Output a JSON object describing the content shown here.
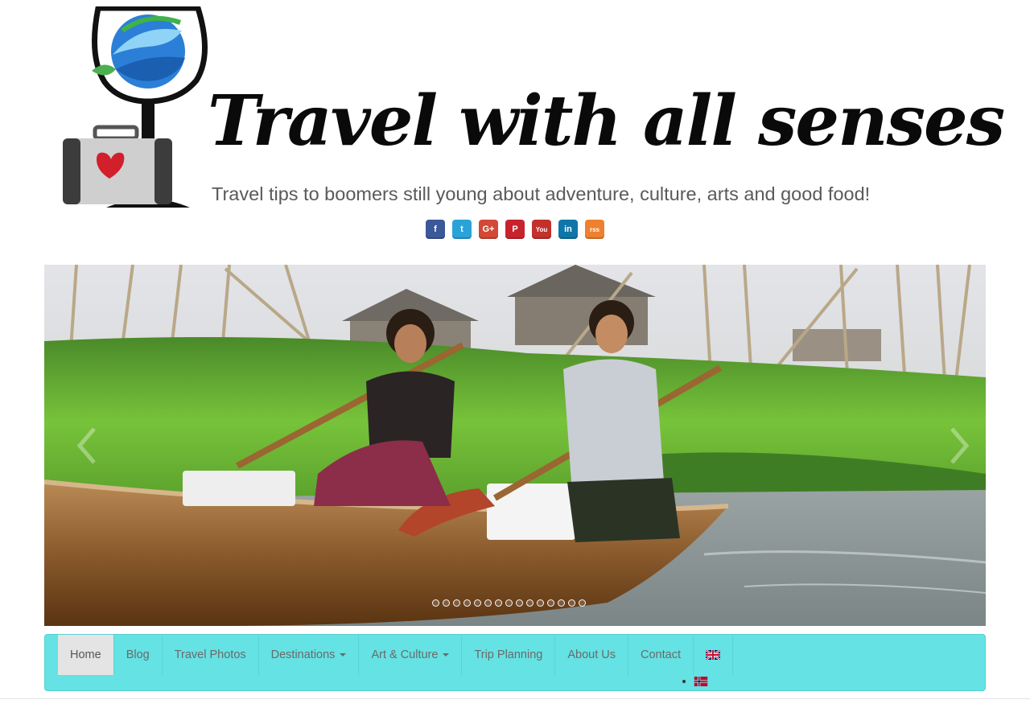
{
  "header": {
    "title": "Travel with all senses",
    "tagline": "Travel tips to boomers still young about adventure, culture, arts and good food!"
  },
  "social": [
    {
      "name": "facebook-icon",
      "color": "#3b5998",
      "glyph": "f"
    },
    {
      "name": "twitter-icon",
      "color": "#2aa3d9",
      "glyph": "t"
    },
    {
      "name": "google-plus-icon",
      "color": "#d34836",
      "glyph": "G+"
    },
    {
      "name": "pinterest-icon",
      "color": "#c8232c",
      "glyph": "P"
    },
    {
      "name": "youtube-icon",
      "color": "#c4302b",
      "glyph": "You"
    },
    {
      "name": "linkedin-icon",
      "color": "#0e76a8",
      "glyph": "in"
    },
    {
      "name": "rss-icon",
      "color": "#ee802f",
      "glyph": "rss"
    }
  ],
  "slider": {
    "slide_count": 15,
    "active_index": 0
  },
  "nav": {
    "items": [
      {
        "label": "Home",
        "active": true,
        "dropdown": false
      },
      {
        "label": "Blog",
        "active": false,
        "dropdown": false
      },
      {
        "label": "Travel Photos",
        "active": false,
        "dropdown": false
      },
      {
        "label": "Destinations",
        "active": false,
        "dropdown": true
      },
      {
        "label": "Art & Culture",
        "active": false,
        "dropdown": true
      },
      {
        "label": "Trip Planning",
        "active": false,
        "dropdown": false
      },
      {
        "label": "About Us",
        "active": false,
        "dropdown": false
      },
      {
        "label": "Contact",
        "active": false,
        "dropdown": false
      }
    ],
    "languages": [
      "uk-flag-icon",
      "norway-flag-icon"
    ]
  },
  "colors": {
    "nav_background": "#64e2e4",
    "nav_active": "#e4e4e4",
    "nav_text": "#6a6a6a"
  }
}
